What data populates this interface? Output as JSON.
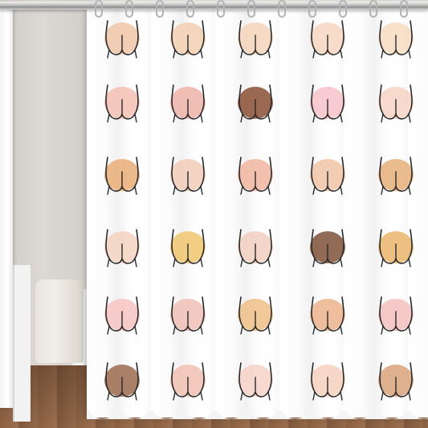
{
  "image": {
    "subject": "shower-curtain",
    "curtain_color": "#ffffff",
    "pattern_columns": 5,
    "pattern_rows": 6,
    "skin_tones": [
      [
        "#f0c6a8",
        "#f2cfb2",
        "#f4d3b8",
        "#f6d6c0",
        "#f8dbc2"
      ],
      [
        "#f3bfb3",
        "#efb3a8",
        "#8a4e33",
        "#f6c2c8",
        "#f7d2c4"
      ],
      [
        "#e8ad76",
        "#f1cbb6",
        "#f2b5a0",
        "#f0c4a6",
        "#e6b079"
      ],
      [
        "#f3d2c0",
        "#eec66f",
        "#f2cec0",
        "#7f5138",
        "#eab46a"
      ],
      [
        "#f6c3c2",
        "#f0bfb6",
        "#eebe86",
        "#ecb48c",
        "#f3c0bd"
      ],
      [
        "#9c6a4e",
        "#f1c0b2",
        "#f6d2c8",
        "#f6d0be",
        "#d9a27a"
      ]
    ],
    "hook_count": 11
  }
}
